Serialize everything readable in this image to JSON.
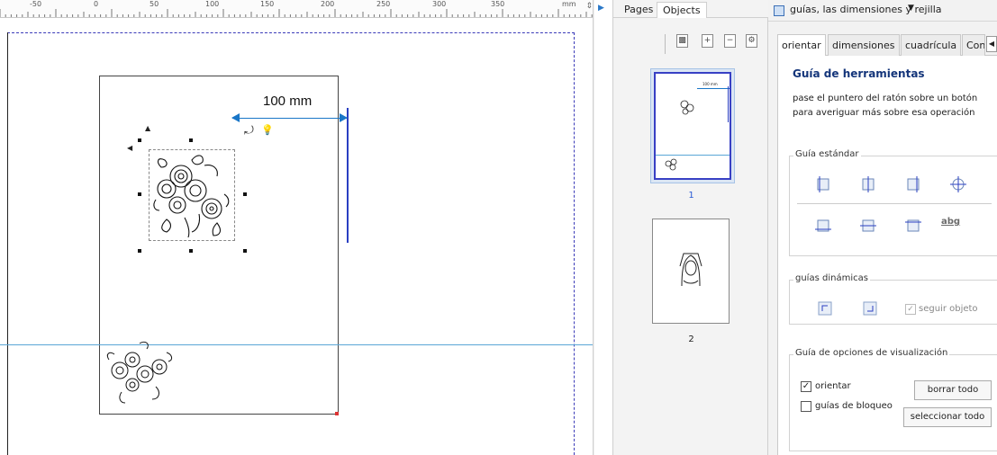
{
  "ruler": {
    "ticks": [
      "-50",
      "0",
      "50",
      "100",
      "150",
      "200",
      "250",
      "300",
      "350"
    ],
    "unit": "mm"
  },
  "canvas": {
    "measurement_label": "100 mm"
  },
  "pages_panel": {
    "tabs": [
      "Pages",
      "Objects"
    ],
    "active_tab": "Objects",
    "toolbar": [
      "background-icon",
      "add-page-icon",
      "remove-page-icon",
      "page-settings-icon"
    ],
    "thumbnails": [
      {
        "label": "1",
        "selected": true
      },
      {
        "label": "2",
        "selected": false
      }
    ],
    "thumb_measure_label": "100 mm"
  },
  "guides_panel": {
    "header_title": "guías, las dimensiones y rejilla",
    "tabs": [
      "orientar",
      "dimensiones",
      "cuadrícula",
      "Conf"
    ],
    "active_tab": "orientar",
    "tool_title": "Guía de herramientas",
    "tool_desc": "pase el puntero del ratón sobre un botón para averiguar más sobre esa operación",
    "standard_section": "Guía estándar",
    "standard_icons": [
      "guide-left-icon",
      "guide-center-v-icon",
      "guide-right-icon",
      "guide-crosshair-icon",
      "guide-bottom-icon",
      "guide-center-h-icon",
      "guide-top-icon"
    ],
    "abg_label": "abg",
    "dynamic_section": "guías dinámicas",
    "follow_object": "seguir objeto",
    "follow_object_checked": true,
    "visibility_section": "Guía de opciones de visualización",
    "orient_label": "orientar",
    "orient_checked": true,
    "lock_label": "guías de bloqueo",
    "lock_checked": false,
    "clear_all": "borrar todo",
    "select_all": "seleccionar todo"
  },
  "colors": {
    "guide_blue": "#2a3fc2",
    "measure_blue": "#1976c7",
    "horizontal_guide": "#5aa6d6",
    "title_navy": "#14357a"
  }
}
